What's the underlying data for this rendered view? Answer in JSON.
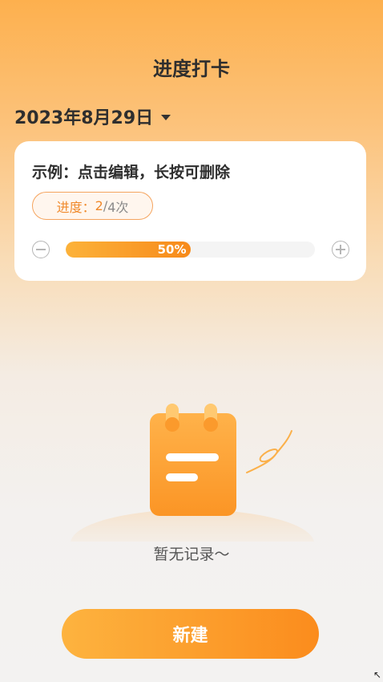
{
  "header": {
    "title": "进度打卡"
  },
  "date_picker": {
    "value": "2023年8月29日"
  },
  "card": {
    "title": "示例：点击编辑，长按可删除",
    "badge": {
      "label": "进度：",
      "current": "2",
      "separator": "/",
      "total": "4次"
    },
    "progress": {
      "percent": 50,
      "text": "50%"
    }
  },
  "empty_state": {
    "text": "暂无记录～"
  },
  "actions": {
    "new_label": "新建"
  },
  "colors": {
    "accent": "#fb8c1d",
    "accent_light": "#fdb33f"
  },
  "icons": {
    "date_dropdown": "caret-down-icon",
    "minus": "minus-circle-icon",
    "plus": "plus-circle-icon",
    "empty": "notepad-icon",
    "corner": "resize-arrow-icon"
  }
}
